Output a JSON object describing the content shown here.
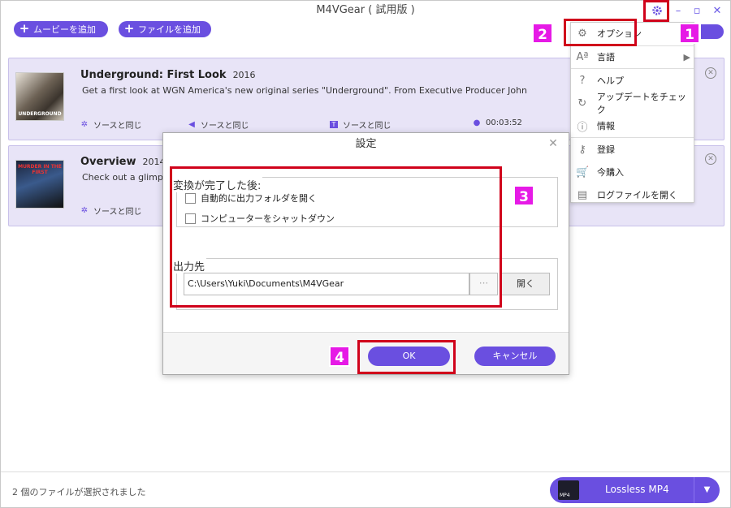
{
  "app": {
    "title": "M4VGear ( 試用版 )"
  },
  "toolbar": {
    "add_movie": "ムービーを追加",
    "add_file": "ファイルを追加"
  },
  "items": [
    {
      "thumb_text": "UNDERGROUND",
      "title": "Underground: First Look",
      "year": "2016",
      "description": "Get a first look at WGN America's new original series \"Underground\". From Executive Producer John",
      "video": "ソースと同じ",
      "audio": "ソースと同じ",
      "subtitle": "ソースと同じ",
      "duration": "00:03:52"
    },
    {
      "thumb_text": "MURDER IN THE FIRST",
      "title": "Overview",
      "year": "2014",
      "description": "Check out a glimpse",
      "video": "ソースと同じ"
    }
  ],
  "menu": {
    "items": [
      {
        "label": "オプション",
        "icon": "gear-icon"
      },
      {
        "label": "言語",
        "icon": "language-icon"
      },
      {
        "label": "ヘルプ",
        "icon": "help-icon"
      },
      {
        "label": "アップデートをチェック",
        "icon": "refresh-icon"
      },
      {
        "label": "情報",
        "icon": "info-icon"
      },
      {
        "label": "登録",
        "icon": "key-icon"
      },
      {
        "label": "今購入",
        "icon": "cart-icon"
      },
      {
        "label": "ログファイルを開く",
        "icon": "log-file-icon"
      }
    ]
  },
  "dialog": {
    "title": "設定",
    "after_conversion_label": "変換が完了した後:",
    "open_folder_label": "自動的に出力フォルダを開く",
    "shutdown_label": "コンピューターをシャットダウン",
    "output_label": "出力先",
    "output_path": "C:\\Users\\Yuki\\Documents\\M4VGear",
    "browse_label": "···",
    "open_label": "開く",
    "ok_label": "OK",
    "cancel_label": "キャンセル"
  },
  "status": {
    "selected_text": "2 個のファイルが選択されました"
  },
  "format": {
    "icon_text": "MP4",
    "label": "Lossless MP4"
  },
  "annotations": [
    "1",
    "2",
    "3",
    "4"
  ],
  "colors": {
    "accent": "#6a4fe0",
    "card_bg": "#e8e4f7",
    "highlight": "#d0021b",
    "step_badge": "#e61ae6"
  }
}
